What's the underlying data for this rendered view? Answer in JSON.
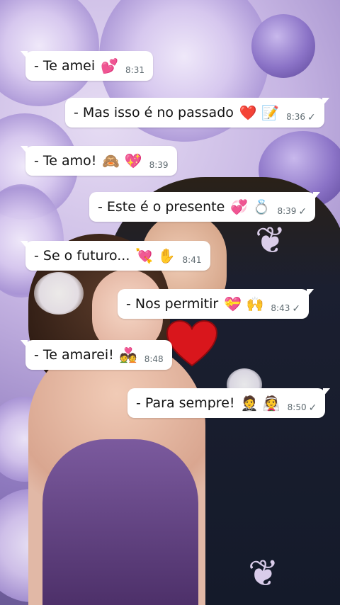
{
  "messages": [
    {
      "text": "- Te amei",
      "emoji": "💕",
      "time": "8:31",
      "check": ""
    },
    {
      "text": "- Mas isso é no passado",
      "emoji": "❤️ 📝",
      "time": "8:36",
      "check": "✓"
    },
    {
      "text": "-  Te amo!",
      "emoji": "🙈 💖",
      "time": "8:39",
      "check": ""
    },
    {
      "text": "- Este é o presente",
      "emoji": "💞 💍",
      "time": "8:39",
      "check": "✓"
    },
    {
      "text": "- Se o futuro...",
      "emoji": "💘 ✋",
      "time": "8:41",
      "check": ""
    },
    {
      "text": "- Nos permitir",
      "emoji": "💝 🙌",
      "time": "8:43",
      "check": "✓"
    },
    {
      "text": "- Te amarei!",
      "emoji": "💑",
      "time": "8:48",
      "check": ""
    },
    {
      "text": "- Para sempre!",
      "emoji": "🤵 👰",
      "time": "8:50",
      "check": "✓"
    }
  ],
  "colors": {
    "bubble": "#ffffff",
    "text": "#121212",
    "meta": "#5e6a70",
    "heart": "#d9161c"
  }
}
